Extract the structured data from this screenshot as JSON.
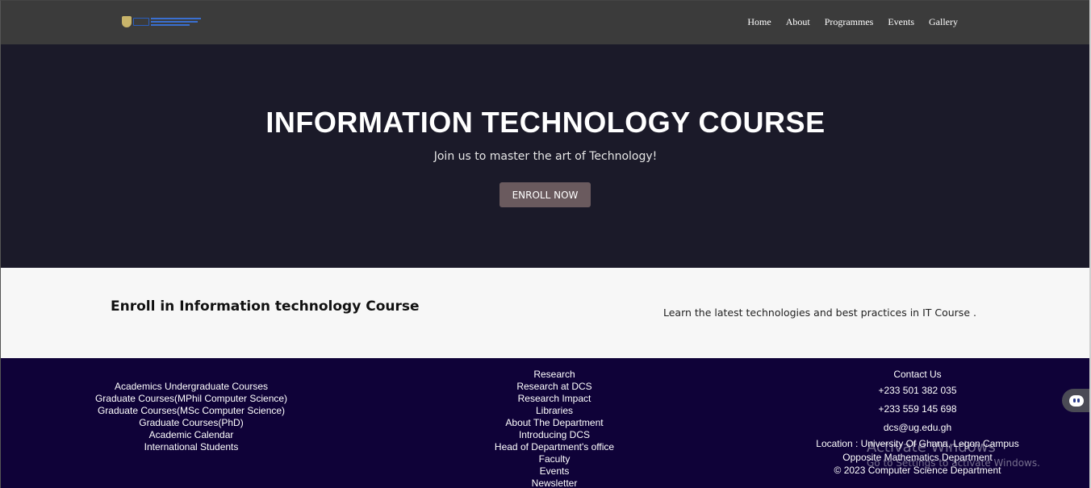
{
  "nav": {
    "items": [
      "Home",
      "About",
      "Programmes",
      "Events",
      "Gallery"
    ]
  },
  "hero": {
    "title": "INFORMATION TECHNOLOGY COURSE",
    "subtitle": "Join us to master the art of Technology!",
    "button_label": "ENROLL NOW"
  },
  "enroll": {
    "heading": "Enroll in Information technology Course",
    "text": "Learn the latest technologies and best practices in IT Course ."
  },
  "footer": {
    "academics": [
      "Academics Undergraduate Courses",
      "Graduate Courses(MPhil Computer Science)",
      "Graduate Courses(MSc Computer Science)",
      "Graduate Courses(PhD)",
      "Academic Calendar",
      "International Students"
    ],
    "research": [
      "Research",
      "Research at DCS",
      "Research Impact",
      "Libraries",
      "About The Department",
      "Introducing DCS",
      "Head of Department's office",
      "Faculty",
      "Events",
      "Newsletter"
    ],
    "contact": {
      "title": "Contact Us",
      "phone1": "+233 501 382 035",
      "phone2": "+233 559 145 698",
      "email": "dcs@ug.edu.gh",
      "location": "Location : University Of Ghana, Legon Campus",
      "location2": "Opposite Mathematics Department",
      "copyright": "© 2023 Computer Science Department"
    }
  },
  "watermark": {
    "line1": "Activate Windows",
    "line2": "Go to Settings to activate Windows."
  },
  "icons": {
    "chat": "chatbot-icon",
    "logo": "university-logo"
  },
  "colors": {
    "navbar": "#3b3b3b",
    "hero": "#1b1a29",
    "button": "#6a5a5e",
    "section": "#f7f7f7",
    "footer": "#0f0238"
  }
}
